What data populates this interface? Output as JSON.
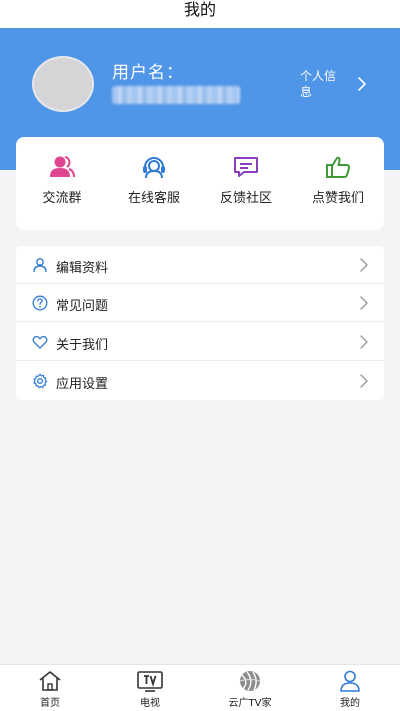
{
  "title": "我的",
  "profile": {
    "username_label": "用户名：",
    "profile_link_label": "个人信息"
  },
  "quick_actions": [
    {
      "label": "交流群",
      "icon": "group-chat-icon",
      "color": "#e0468f"
    },
    {
      "label": "在线客服",
      "icon": "customer-service-icon",
      "color": "#2f7bd8"
    },
    {
      "label": "反馈社区",
      "icon": "feedback-icon",
      "color": "#8a3fbf"
    },
    {
      "label": "点赞我们",
      "icon": "thumbs-up-icon",
      "color": "#3f9a3a"
    }
  ],
  "menu": [
    {
      "label": "编辑资料",
      "icon": "user-icon"
    },
    {
      "label": "常见问题",
      "icon": "question-circle-icon"
    },
    {
      "label": "关于我们",
      "icon": "heart-icon"
    },
    {
      "label": "应用设置",
      "icon": "gear-icon"
    }
  ],
  "tabs": [
    {
      "label": "首页",
      "icon": "home-icon",
      "active": false
    },
    {
      "label": "电视",
      "icon": "tv-icon",
      "active": false
    },
    {
      "label": "云广TV家",
      "icon": "globe-logo-icon",
      "active": false
    },
    {
      "label": "我的",
      "icon": "person-icon",
      "active": true
    }
  ],
  "colors": {
    "header_blue": "#4f95e8",
    "page_bg": "#f3f4f6",
    "menu_icon_blue": "#2f7bd8"
  }
}
